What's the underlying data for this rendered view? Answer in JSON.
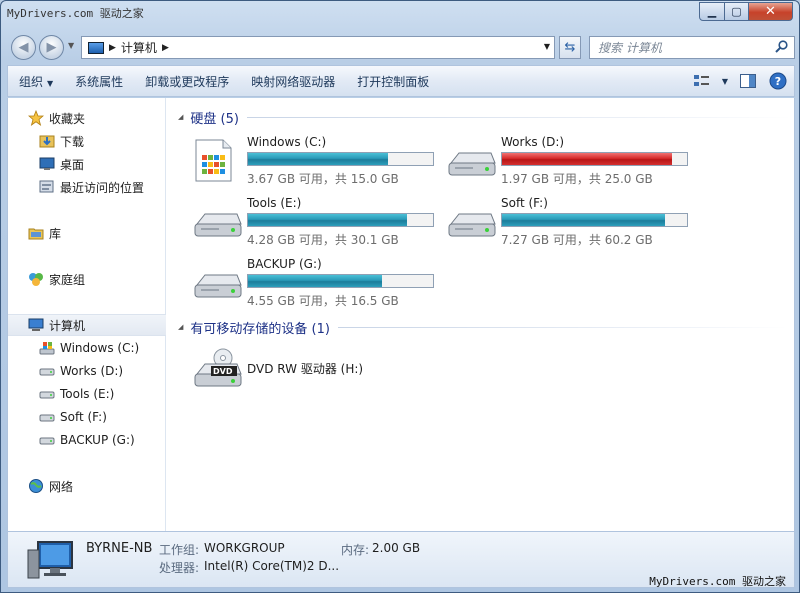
{
  "window": {
    "watermark": "MyDrivers.com 驱动之家",
    "minimize_label": "▁",
    "maximize_label": "▢",
    "close_label": "✕"
  },
  "nav": {
    "address": "计算机",
    "search_placeholder": "搜索 计算机"
  },
  "toolbar": {
    "items": [
      "组织",
      "系统属性",
      "卸载或更改程序",
      "映射网络驱动器",
      "打开控制面板"
    ]
  },
  "navpane": {
    "favorites": "收藏夹",
    "downloads": "下载",
    "desktop": "桌面",
    "recent": "最近访问的位置",
    "libraries": "库",
    "homegroup": "家庭组",
    "computer": "计算机",
    "drives": [
      "Windows (C:)",
      "Works (D:)",
      "Tools (E:)",
      "Soft (F:)",
      "BACKUP (G:)"
    ],
    "network": "网络"
  },
  "content": {
    "hdd_group": "硬盘 (5)",
    "removable_group": "有可移动存储的设备 (1)",
    "drives": [
      {
        "name": "Windows (C:)",
        "free_text": "3.67 GB 可用，共 15.0 GB",
        "used_fraction": 0.755,
        "status": "normal"
      },
      {
        "name": "Works (D:)",
        "free_text": "1.97 GB 可用，共 25.0 GB",
        "used_fraction": 0.921,
        "status": "full"
      },
      {
        "name": "Tools (E:)",
        "free_text": "4.28 GB 可用，共 30.1 GB",
        "used_fraction": 0.858,
        "status": "normal"
      },
      {
        "name": "Soft (F:)",
        "free_text": "7.27 GB 可用，共 60.2 GB",
        "used_fraction": 0.879,
        "status": "normal"
      },
      {
        "name": "BACKUP (G:)",
        "free_text": "4.55 GB 可用，共 16.5 GB",
        "used_fraction": 0.724,
        "status": "normal"
      }
    ],
    "dvd": {
      "name": "DVD RW 驱动器 (H:)",
      "badge": "DVD"
    }
  },
  "details": {
    "name": "BYRNE-NB",
    "workgroup_label": "工作组:",
    "workgroup_value": "WORKGROUP",
    "memory_label": "内存:",
    "memory_value": "2.00 GB",
    "cpu_label": "处理器:",
    "cpu_value": "Intel(R) Core(TM)2 D...",
    "watermark": "MyDrivers.com 驱动之家"
  }
}
